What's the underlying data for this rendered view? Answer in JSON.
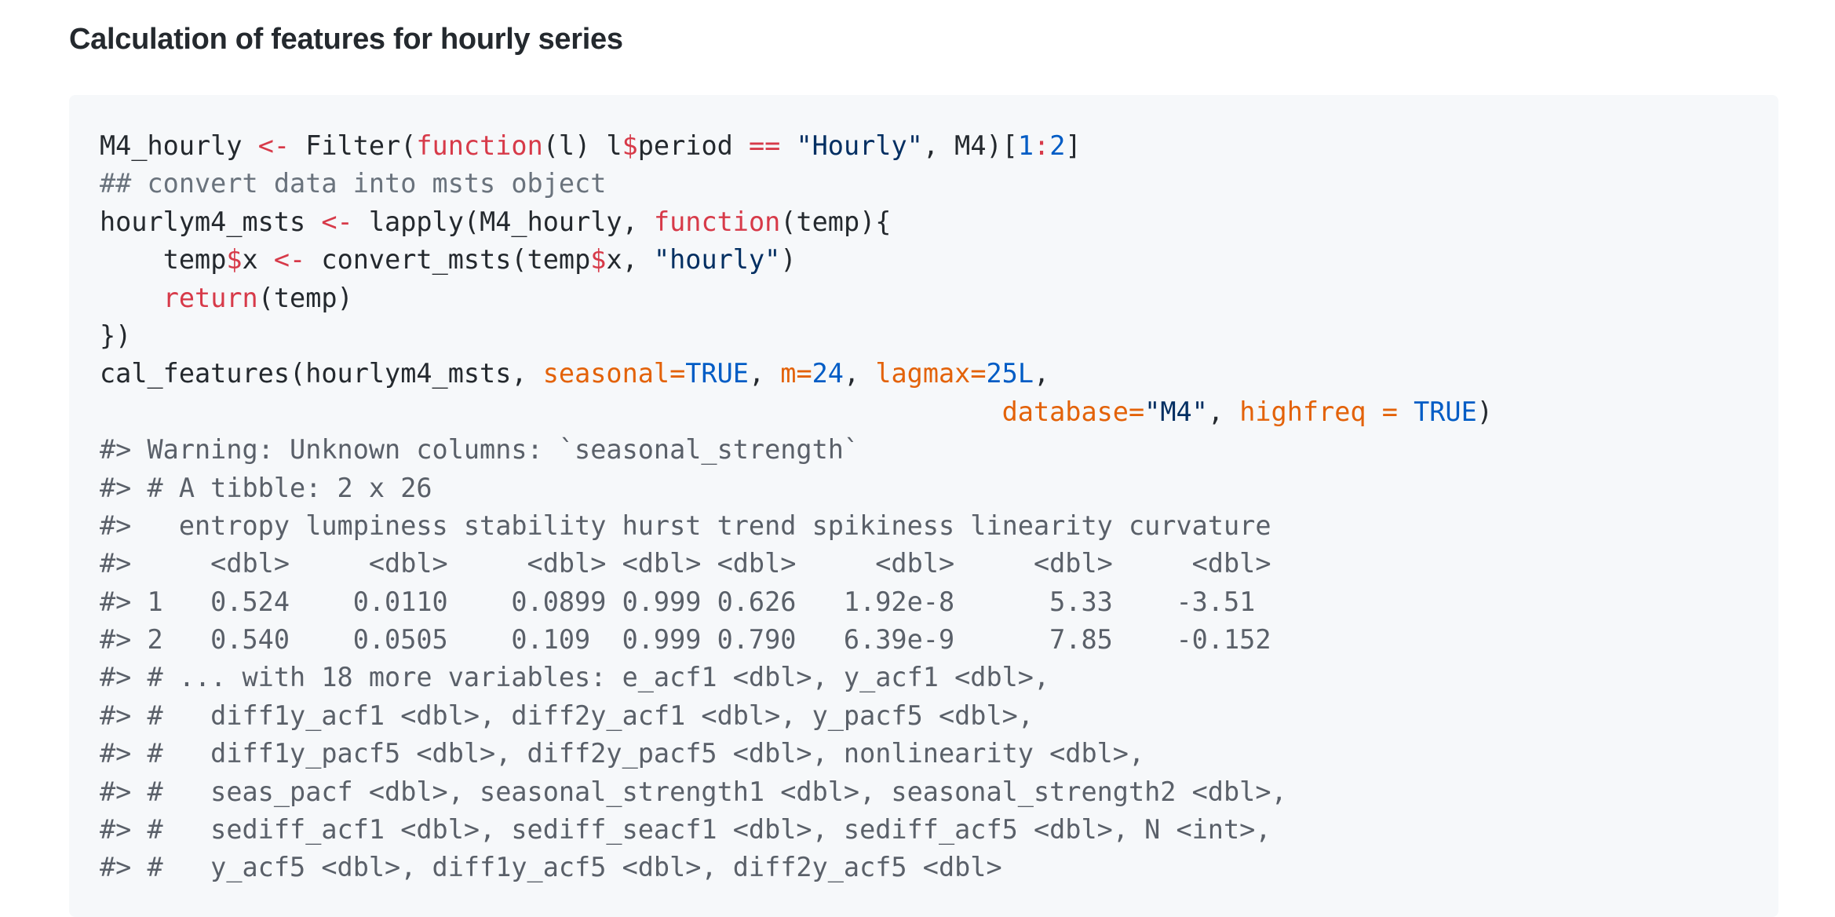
{
  "heading": "Calculation of features for hourly series",
  "code": {
    "l1": {
      "a": "M4_hourly ",
      "assign": "<-",
      "b": " Filter(",
      "fn": "function",
      "c": "(l) l",
      "dollar": "$",
      "d": "period ",
      "eq": "==",
      "e": " ",
      "str": "\"Hourly\"",
      "f": ", M4)[",
      "n1": "1",
      "colon": ":",
      "n2": "2",
      "g": "]"
    },
    "l2": {
      "comment": "## convert data into msts object"
    },
    "l3": {
      "a": "hourlym4_msts ",
      "assign": "<-",
      "b": " lapply(M4_hourly, ",
      "fn": "function",
      "c": "(temp){"
    },
    "l4": {
      "indent": "    ",
      "a": "temp",
      "d1": "$",
      "b": "x ",
      "assign": "<-",
      "c": " convert_msts(temp",
      "d2": "$",
      "e": "x, ",
      "str": "\"hourly\"",
      "f": ")"
    },
    "l5": {
      "indent": "    ",
      "kw": "return",
      "a": "(temp)"
    },
    "l6": {
      "a": "})"
    },
    "l7": {
      "a": "cal_features(hourlym4_msts, ",
      "arg1": "seasonal",
      "eq1": "=",
      "v1": "TRUE",
      "s1": ", ",
      "arg2": "m",
      "eq2": "=",
      "v2": "24",
      "s2": ", ",
      "arg3": "lagmax",
      "eq3": "=",
      "v3": "25L",
      "s3": ","
    },
    "l8": {
      "indent": "                                                         ",
      "arg1": "database",
      "eq1": "=",
      "v1": "\"M4\"",
      "s1": ", ",
      "arg2": "highfreq",
      "eq2": " = ",
      "v2": "TRUE",
      "s2": ")"
    },
    "output": [
      "#> Warning: Unknown columns: `seasonal_strength`",
      "#> # A tibble: 2 x 26",
      "#>   entropy lumpiness stability hurst trend spikiness linearity curvature",
      "#>     <dbl>     <dbl>     <dbl> <dbl> <dbl>     <dbl>     <dbl>     <dbl>",
      "#> 1   0.524    0.0110    0.0899 0.999 0.626   1.92e-8      5.33    -3.51",
      "#> 2   0.540    0.0505    0.109  0.999 0.790   6.39e-9      7.85    -0.152",
      "#> # ... with 18 more variables: e_acf1 <dbl>, y_acf1 <dbl>,",
      "#> #   diff1y_acf1 <dbl>, diff2y_acf1 <dbl>, y_pacf5 <dbl>,",
      "#> #   diff1y_pacf5 <dbl>, diff2y_pacf5 <dbl>, nonlinearity <dbl>,",
      "#> #   seas_pacf <dbl>, seasonal_strength1 <dbl>, seasonal_strength2 <dbl>,",
      "#> #   sediff_acf1 <dbl>, sediff_seacf1 <dbl>, sediff_acf5 <dbl>, N <int>,",
      "#> #   y_acf5 <dbl>, diff1y_acf5 <dbl>, diff2y_acf5 <dbl>"
    ]
  }
}
